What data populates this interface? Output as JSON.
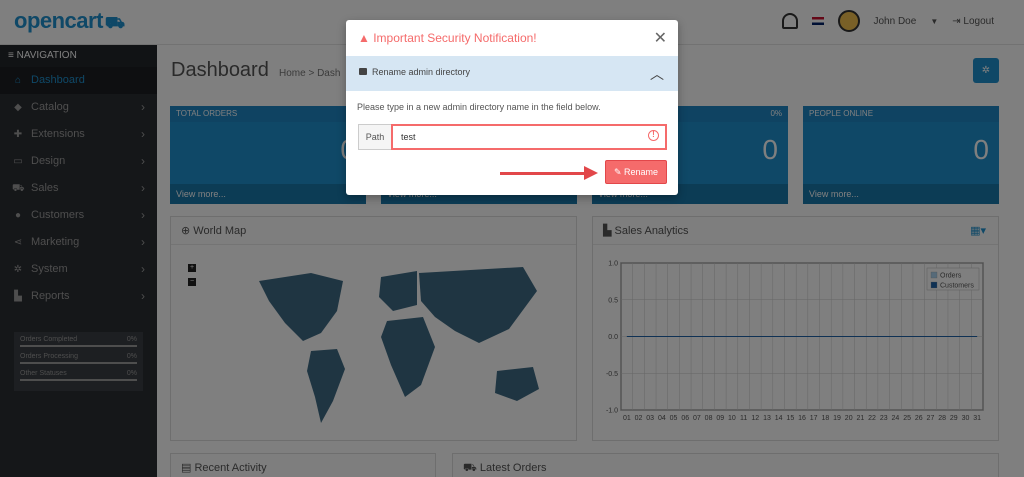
{
  "brand": {
    "logo_text": "opencart",
    "logo_cart": "⛟"
  },
  "header": {
    "user_name": "John Doe",
    "logout_label": "Logout"
  },
  "sidebar": {
    "heading": "≡ NAVIGATION",
    "items": [
      {
        "label": "Dashboard",
        "icon": "home-icon",
        "glyph": "⌂"
      },
      {
        "label": "Catalog",
        "icon": "tag-icon",
        "glyph": "◆"
      },
      {
        "label": "Extensions",
        "icon": "puzzle-icon",
        "glyph": "✚"
      },
      {
        "label": "Design",
        "icon": "monitor-icon",
        "glyph": "▭"
      },
      {
        "label": "Sales",
        "icon": "cart-icon",
        "glyph": "⛟"
      },
      {
        "label": "Customers",
        "icon": "user-icon",
        "glyph": "●"
      },
      {
        "label": "Marketing",
        "icon": "share-icon",
        "glyph": "⋖"
      },
      {
        "label": "System",
        "icon": "cog-icon",
        "glyph": "✲"
      },
      {
        "label": "Reports",
        "icon": "bar-chart-icon",
        "glyph": "▙"
      }
    ],
    "stats": [
      {
        "label": "Orders Completed",
        "value": "0%"
      },
      {
        "label": "Orders Processing",
        "value": "0%"
      },
      {
        "label": "Other Statuses",
        "value": "0%"
      }
    ]
  },
  "page": {
    "title": "Dashboard",
    "breadcrumb": "Home  >  Dash"
  },
  "tiles": [
    {
      "title": "TOTAL ORDERS",
      "percent": "",
      "value": "0",
      "footer": "View more..."
    },
    {
      "title": "",
      "percent": "",
      "value": "",
      "footer": "View more..."
    },
    {
      "title": "",
      "percent": "0%",
      "value": "0",
      "footer": "View more..."
    },
    {
      "title": "PEOPLE ONLINE",
      "percent": "",
      "value": "0",
      "footer": "View more..."
    }
  ],
  "panels": {
    "world_map": "World Map",
    "sales_analytics": "Sales Analytics",
    "recent_activity": "Recent Activity",
    "latest_orders": "Latest Orders"
  },
  "chart_data": {
    "type": "line",
    "title": "Sales Analytics",
    "x": [
      "01",
      "02",
      "03",
      "04",
      "05",
      "06",
      "07",
      "08",
      "09",
      "10",
      "11",
      "12",
      "13",
      "14",
      "15",
      "16",
      "17",
      "18",
      "19",
      "20",
      "21",
      "22",
      "23",
      "24",
      "25",
      "26",
      "27",
      "28",
      "29",
      "30",
      "31"
    ],
    "series": [
      {
        "name": "Orders",
        "values": [
          0,
          0,
          0,
          0,
          0,
          0,
          0,
          0,
          0,
          0,
          0,
          0,
          0,
          0,
          0,
          0,
          0,
          0,
          0,
          0,
          0,
          0,
          0,
          0,
          0,
          0,
          0,
          0,
          0,
          0,
          0
        ]
      },
      {
        "name": "Customers",
        "values": [
          0,
          0,
          0,
          0,
          0,
          0,
          0,
          0,
          0,
          0,
          0,
          0,
          0,
          0,
          0,
          0,
          0,
          0,
          0,
          0,
          0,
          0,
          0,
          0,
          0,
          0,
          0,
          0,
          0,
          0,
          0
        ]
      }
    ],
    "ylim": [
      -1.0,
      1.0
    ],
    "yticks": [
      "1.0",
      "0.5",
      "0.0",
      "-0.5",
      "-1.0"
    ],
    "legend": "top-right",
    "grid": true,
    "colors": {
      "Orders": "#acd5f2",
      "Customers": "#1e63a8"
    }
  },
  "modal": {
    "title": "Important Security Notification!",
    "section_label": "Rename admin directory",
    "description": "Please type in a new admin directory name in the field below.",
    "path_label": "Path",
    "path_value": "test",
    "button_label": "Rename"
  }
}
